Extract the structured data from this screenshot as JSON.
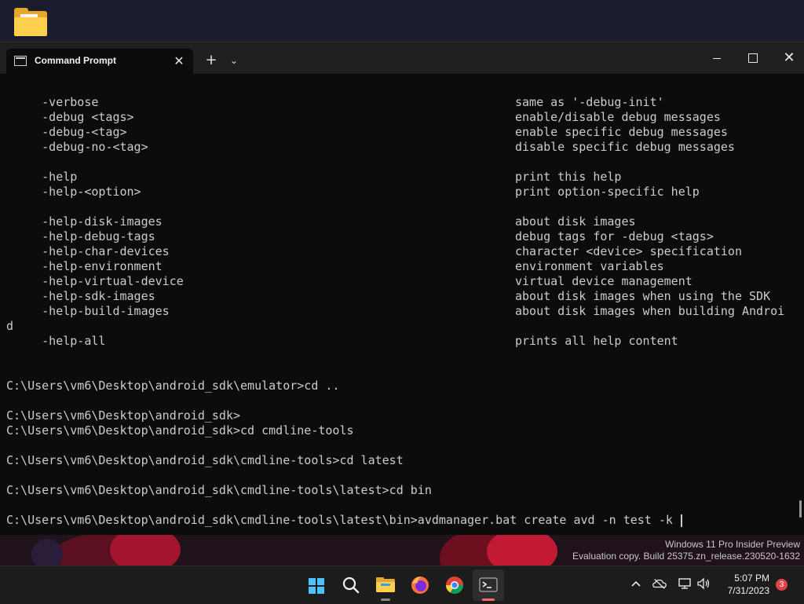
{
  "window": {
    "tab_title": "Command Prompt",
    "tab_close": "✕",
    "new_tab": "+",
    "dropdown": "⌄",
    "minimize": "—",
    "close": "✕"
  },
  "terminal": {
    "help_rows": [
      {
        "opt": "     -verbose",
        "desc": "same as '-debug-init'"
      },
      {
        "opt": "     -debug <tags>",
        "desc": "enable/disable debug messages"
      },
      {
        "opt": "     -debug-<tag>",
        "desc": "enable specific debug messages"
      },
      {
        "opt": "     -debug-no-<tag>",
        "desc": "disable specific debug messages"
      },
      {
        "opt": "",
        "desc": ""
      },
      {
        "opt": "     -help",
        "desc": "print this help"
      },
      {
        "opt": "     -help-<option>",
        "desc": "print option-specific help"
      },
      {
        "opt": "",
        "desc": ""
      },
      {
        "opt": "     -help-disk-images",
        "desc": "about disk images"
      },
      {
        "opt": "     -help-debug-tags",
        "desc": "debug tags for -debug <tags>"
      },
      {
        "opt": "     -help-char-devices",
        "desc": "character <device> specification"
      },
      {
        "opt": "     -help-environment",
        "desc": "environment variables"
      },
      {
        "opt": "     -help-virtual-device",
        "desc": "virtual device management"
      },
      {
        "opt": "     -help-sdk-images",
        "desc": "about disk images when using the SDK"
      },
      {
        "opt": "     -help-build-images",
        "desc": "about disk images when building Androi"
      },
      {
        "opt": "d",
        "desc": ""
      },
      {
        "opt": "     -help-all",
        "desc": "prints all help content"
      }
    ],
    "commands": [
      "C:\\Users\\vm6\\Desktop\\android_sdk\\emulator>cd ..",
      "",
      "C:\\Users\\vm6\\Desktop\\android_sdk>",
      "C:\\Users\\vm6\\Desktop\\android_sdk>cd cmdline-tools",
      "",
      "C:\\Users\\vm6\\Desktop\\android_sdk\\cmdline-tools>cd latest",
      "",
      "C:\\Users\\vm6\\Desktop\\android_sdk\\cmdline-tools\\latest>cd bin",
      ""
    ],
    "current_prompt": "C:\\Users\\vm6\\Desktop\\android_sdk\\cmdline-tools\\latest\\bin>",
    "current_input": "avdmanager.bat create avd -n test -k "
  },
  "watermark": {
    "line1": "Windows 11 Pro Insider Preview",
    "line2": "Evaluation copy. Build 25375.zn_release.230520-1632"
  },
  "taskbar": {
    "apps": [
      "start-icon",
      "search-icon",
      "file-explorer-icon",
      "firefox-icon",
      "chrome-icon",
      "terminal-icon"
    ],
    "time": "5:07 PM",
    "date": "7/31/2023",
    "notification_count": "3"
  },
  "colors": {
    "terminal_bg": "#0c0c0c",
    "terminal_text": "#cccccc",
    "titlebar": "#202020",
    "accent": "#4cc2ff"
  }
}
